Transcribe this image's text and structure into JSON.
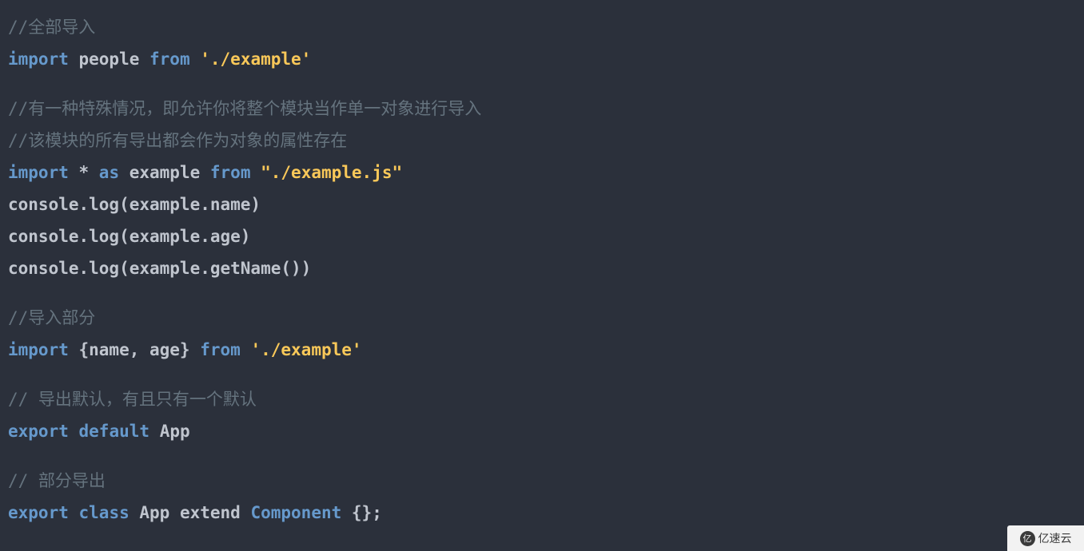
{
  "editor": {
    "background": "#2b303b",
    "colors": {
      "comment": "#65737e",
      "keyword": "#6699cc",
      "plain": "#c0c5ce",
      "string": "#f9c859"
    },
    "lines": [
      {
        "id": "l1",
        "type": "code",
        "tokens": [
          {
            "t": "//全部导入",
            "c": "comment"
          }
        ]
      },
      {
        "id": "l2",
        "type": "code",
        "tokens": [
          {
            "t": "import",
            "c": "keyword"
          },
          {
            "t": " people ",
            "c": "plain"
          },
          {
            "t": "from",
            "c": "keyword"
          },
          {
            "t": " ",
            "c": "plain"
          },
          {
            "t": "'./example'",
            "c": "string"
          }
        ]
      },
      {
        "id": "l3",
        "type": "blank",
        "tokens": []
      },
      {
        "id": "l4",
        "type": "code",
        "tokens": [
          {
            "t": "//有一种特殊情况，即允许你将整个模块当作单一对象进行导入",
            "c": "comment"
          }
        ]
      },
      {
        "id": "l5",
        "type": "code",
        "tokens": [
          {
            "t": "//该模块的所有导出都会作为对象的属性存在",
            "c": "comment"
          }
        ]
      },
      {
        "id": "l6",
        "type": "code",
        "tokens": [
          {
            "t": "import",
            "c": "keyword"
          },
          {
            "t": " * ",
            "c": "plain"
          },
          {
            "t": "as",
            "c": "keyword"
          },
          {
            "t": " example ",
            "c": "plain"
          },
          {
            "t": "from",
            "c": "keyword"
          },
          {
            "t": " ",
            "c": "plain"
          },
          {
            "t": "\"./example.js\"",
            "c": "string"
          }
        ]
      },
      {
        "id": "l7",
        "type": "code",
        "tokens": [
          {
            "t": "console.log(example.name)",
            "c": "plain"
          }
        ]
      },
      {
        "id": "l8",
        "type": "code",
        "tokens": [
          {
            "t": "console.log(example.age)",
            "c": "plain"
          }
        ]
      },
      {
        "id": "l9",
        "type": "code",
        "tokens": [
          {
            "t": "console.log(example.getName())",
            "c": "plain"
          }
        ]
      },
      {
        "id": "l10",
        "type": "blank",
        "tokens": []
      },
      {
        "id": "l11",
        "type": "code",
        "tokens": [
          {
            "t": "//导入部分",
            "c": "comment"
          }
        ]
      },
      {
        "id": "l12",
        "type": "code",
        "tokens": [
          {
            "t": "import",
            "c": "keyword"
          },
          {
            "t": " {name, age} ",
            "c": "plain"
          },
          {
            "t": "from",
            "c": "keyword"
          },
          {
            "t": " ",
            "c": "plain"
          },
          {
            "t": "'./example'",
            "c": "string"
          }
        ]
      },
      {
        "id": "l13",
        "type": "blank",
        "tokens": []
      },
      {
        "id": "l14",
        "type": "code",
        "tokens": [
          {
            "t": "// 导出默认，有且只有一个默认",
            "c": "comment"
          }
        ]
      },
      {
        "id": "l15",
        "type": "code",
        "tokens": [
          {
            "t": "export",
            "c": "keyword"
          },
          {
            "t": " ",
            "c": "plain"
          },
          {
            "t": "default",
            "c": "keyword"
          },
          {
            "t": " ",
            "c": "plain"
          },
          {
            "t": "App",
            "c": "plain"
          }
        ]
      },
      {
        "id": "l16",
        "type": "blank",
        "tokens": []
      },
      {
        "id": "l17",
        "type": "code",
        "tokens": [
          {
            "t": "// 部分导出",
            "c": "comment"
          }
        ]
      },
      {
        "id": "l18",
        "type": "code",
        "tokens": [
          {
            "t": "export",
            "c": "keyword"
          },
          {
            "t": " ",
            "c": "plain"
          },
          {
            "t": "class",
            "c": "keyword"
          },
          {
            "t": " App ",
            "c": "plain"
          },
          {
            "t": "extend",
            "c": "plain"
          },
          {
            "t": " ",
            "c": "plain"
          },
          {
            "t": "Component",
            "c": "keyword"
          },
          {
            "t": " {};",
            "c": "plain"
          }
        ]
      }
    ]
  },
  "watermark": {
    "logo_glyph": "亿",
    "text": "亿速云"
  }
}
